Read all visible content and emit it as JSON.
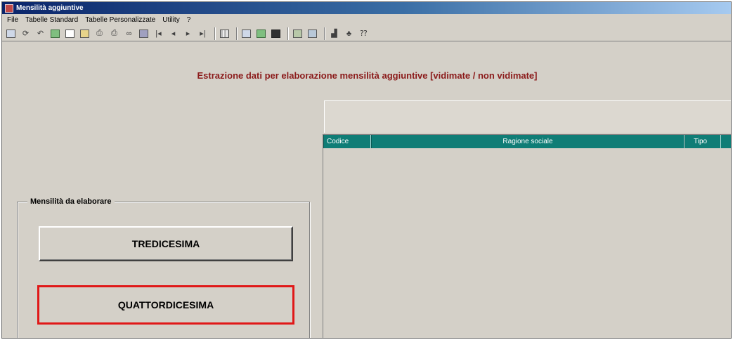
{
  "window": {
    "title": "Mensilità aggiuntive"
  },
  "menu": {
    "items": [
      "File",
      "Tabelle Standard",
      "Tabelle Personalizzate",
      "Utility",
      "?"
    ]
  },
  "toolbar": {
    "icons": [
      "save-icon",
      "refresh-icon",
      "undo-icon",
      "user-icon",
      "new-document-icon",
      "open-folder-icon",
      "print-icon",
      "print-preview-icon",
      "binoculars-icon",
      "folder-icon",
      "first-record-icon",
      "previous-record-icon",
      "next-record-icon",
      "last-record-icon",
      "grid-icon",
      "chart-icon",
      "calendar-icon",
      "terminal-icon",
      "report-icon",
      "export-icon",
      "stats-icon",
      "tree-icon",
      "help-icon"
    ]
  },
  "heading": {
    "text": "Estrazione dati per elaborazione mensilità aggiuntive [vidimate / non vidimate]"
  },
  "grid": {
    "columns": [
      "Codice",
      "Ragione sociale",
      "Tipo"
    ],
    "rows": [],
    "header_color": "#0f7d76"
  },
  "groupbox": {
    "label": "Mensilità da elaborare",
    "buttons": {
      "tredicesima": "TREDICESIMA",
      "quattordicesima": "QUATTORDICESIMA"
    }
  },
  "colors": {
    "heading": "#8b1a1a",
    "highlight_border": "#e01818",
    "window_bg": "#d4d0c8"
  }
}
